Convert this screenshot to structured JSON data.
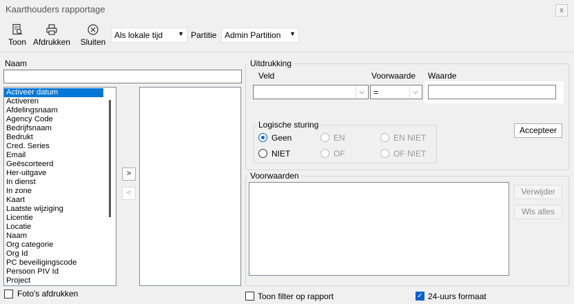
{
  "window": {
    "title": "Kaarthouders rapportage",
    "close_label": "x"
  },
  "toolbar": {
    "show_label": "Toon",
    "print_label": "Afdrukken",
    "close_label": "Sluiten",
    "time_select": "Als lokale tijd",
    "partition_label": "Partitie",
    "partition_select": "Admin Partition"
  },
  "name_section": {
    "label": "Naam",
    "search_value": "",
    "fields": [
      "Activeer datum",
      "Activeren",
      "Afdelingsnaam",
      "Agency Code",
      "Bedrijfsnaam",
      "Bedrukt",
      "Cred. Series",
      "Email",
      "Geëscorteerd",
      "Her-uitgave",
      "In dienst",
      "In zone",
      "Kaart",
      "Laatste wijziging",
      "Licentie",
      "Locatie",
      "Naam",
      "Org categorie",
      "Org Id",
      "PC beveiligingscode",
      "Persoon PIV Id",
      "Project"
    ],
    "selected_index": 0,
    "add_label": ">",
    "remove_label": "<",
    "print_photos_label": "Foto's afdrukken"
  },
  "expression": {
    "title": "Uitdrukking",
    "field_label": "Veld",
    "field_value": "",
    "condition_label": "Voorwaarde",
    "condition_value": "=",
    "value_label": "Waarde",
    "value_value": "",
    "logic_title": "Logische sturing",
    "logic_options": [
      {
        "label": "Geen",
        "checked": true,
        "enabled": true
      },
      {
        "label": "EN",
        "checked": false,
        "enabled": false
      },
      {
        "label": "EN NIET",
        "checked": false,
        "enabled": false
      },
      {
        "label": "NIET",
        "checked": false,
        "enabled": true
      },
      {
        "label": "OF",
        "checked": false,
        "enabled": false
      },
      {
        "label": "OF NIET",
        "checked": false,
        "enabled": false
      }
    ],
    "accept_label": "Accepteer"
  },
  "conditions": {
    "title": "Voorwaarden",
    "delete_label": "Verwijder",
    "clear_label": "Wis alles"
  },
  "footer": {
    "show_filter_label": "Toon filter op rapport",
    "show_filter_checked": false,
    "hour24_label": "24-uurs formaat",
    "hour24_checked": true
  },
  "colors": {
    "selection": "#0078d7",
    "accent": "#0a63c9"
  }
}
